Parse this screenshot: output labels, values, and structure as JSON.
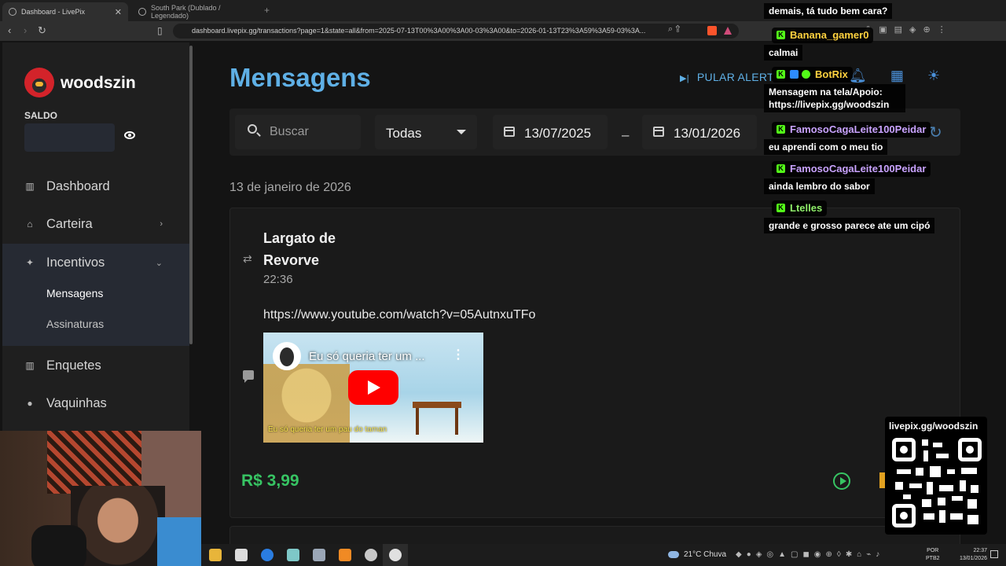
{
  "browser": {
    "tabs": [
      {
        "label": "Dashboard - LivePix",
        "active": true
      },
      {
        "label": "South Park (Dublado / Legendado)",
        "active": false
      }
    ],
    "url": "dashboard.livepix.gg/transactions?page=1&state=all&from=2025-07-13T00%3A00%3A00-03%3A00&to=2026-01-13T23%3A59%3A59-03%3A..."
  },
  "sidebar": {
    "username": "woodszin",
    "balance_label": "SALDO",
    "items": [
      {
        "label": "Dashboard",
        "icon": "chart-icon"
      },
      {
        "label": "Carteira",
        "icon": "bank-icon"
      },
      {
        "label": "Incentivos",
        "icon": "sparkle-icon"
      },
      {
        "label": "Enquetes",
        "icon": "poll-icon"
      },
      {
        "label": "Vaquinhas",
        "icon": "piggy-icon"
      }
    ],
    "subitems": [
      "Mensagens",
      "Assinaturas"
    ]
  },
  "main": {
    "title": "Mensagens",
    "skip_alert_label": "PULAR ALERT",
    "filters": {
      "search_placeholder": "Buscar",
      "state": "Todas",
      "date_from": "13/07/2025",
      "date_sep": "–",
      "date_to": "13/01/2026"
    },
    "date_heading": "13 de janeiro de 2026",
    "message": {
      "sender": "Largato de Revorve",
      "time": "22:36",
      "link": "https://www.youtube.com/watch?v=05AutnxuTFo",
      "video_title": "Eu só queria ter um ...",
      "video_subtitle": "Eu só queria ter um pau do taman",
      "amount": "R$ 3,99"
    }
  },
  "chat": {
    "messages": [
      {
        "user": "",
        "text": "demais, tá tudo bem cara?"
      },
      {
        "user": "Banana_gamer0",
        "color": "#ffd23f",
        "text": "calmai"
      },
      {
        "user": "BotRix",
        "color": "#ffd23f",
        "text": "Mensagem na tela/Apoio: https://livepix.gg/woodszin"
      },
      {
        "user": "FamosoCagaLeite100Peidar",
        "color": "#c9a3ff",
        "text": "eu aprendi com o meu tio"
      },
      {
        "user": "FamosoCagaLeite100Peidar",
        "color": "#c9a3ff",
        "text": "ainda lembro do sabor"
      },
      {
        "user": "Ltelles",
        "color": "#8fef6a",
        "text": "grande e grosso parece ate um cipó"
      }
    ]
  },
  "qr": {
    "label": "livepix.gg/woodszin"
  },
  "taskbar": {
    "weather": "21°C  Chuva",
    "lang": "POR",
    "lang2": "PTB2",
    "time": "22:37",
    "date": "13/01/2026"
  }
}
